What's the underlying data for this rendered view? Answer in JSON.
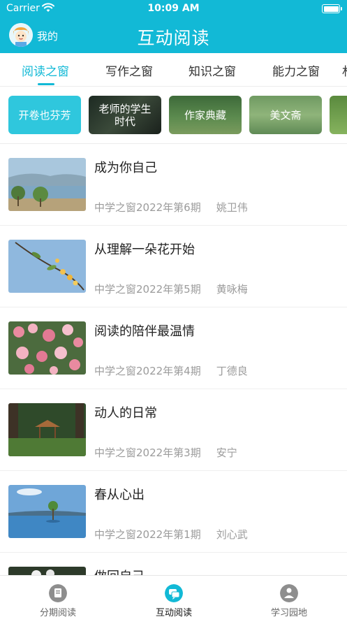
{
  "status": {
    "carrier": "Carrier",
    "time": "10:09 AM"
  },
  "header": {
    "me_label": "我的",
    "title": "互动阅读"
  },
  "tabs": [
    {
      "label": "阅读之窗",
      "active": true
    },
    {
      "label": "写作之窗",
      "active": false
    },
    {
      "label": "知识之窗",
      "active": false
    },
    {
      "label": "能力之窗",
      "active": false
    },
    {
      "label": "札",
      "active": false
    }
  ],
  "categories": [
    {
      "label": "开卷也芬芳",
      "style": "solid-cyan"
    },
    {
      "label": "老师的学生时代",
      "style": "dark-photo"
    },
    {
      "label": "作家典藏",
      "style": "forest-photo"
    },
    {
      "label": "美文斋",
      "style": "meadow-photo"
    }
  ],
  "articles": [
    {
      "title": "成为你自己",
      "source": "中学之窗2022年第6期",
      "author": "姚卫伟",
      "thumb": "lake-trees"
    },
    {
      "title": "从理解一朵花开始",
      "source": "中学之窗2022年第5期",
      "author": "黄咏梅",
      "thumb": "blossom-branch"
    },
    {
      "title": "阅读的陪伴最温情",
      "source": "中学之窗2022年第4期",
      "author": "丁德良",
      "thumb": "rose-bush"
    },
    {
      "title": "动人的日常",
      "source": "中学之窗2022年第3期",
      "author": "安宁",
      "thumb": "pavilion-forest"
    },
    {
      "title": "春从心出",
      "source": "中学之窗2022年第1期",
      "author": "刘心武",
      "thumb": "tree-in-lake"
    },
    {
      "title": "做回自己",
      "source": "",
      "author": "",
      "thumb": "flowers"
    }
  ],
  "bottom_nav": [
    {
      "label": "分期阅读",
      "icon": "issues-icon",
      "active": false
    },
    {
      "label": "互动阅读",
      "icon": "chat-icon",
      "active": true
    },
    {
      "label": "学习园地",
      "icon": "study-icon",
      "active": false
    }
  ],
  "colors": {
    "accent": "#12b9d6",
    "meta_text": "#9b9b9b"
  }
}
